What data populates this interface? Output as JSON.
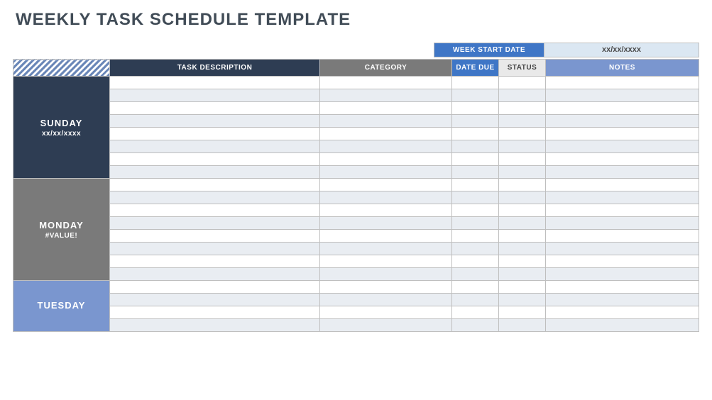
{
  "title": "WEEKLY TASK SCHEDULE TEMPLATE",
  "week_start": {
    "label": "WEEK START DATE",
    "value": "xx/xx/xxxx"
  },
  "columns": {
    "task": "TASK DESCRIPTION",
    "category": "CATEGORY",
    "date_due": "DATE DUE",
    "status": "STATUS",
    "notes": "NOTES"
  },
  "days": {
    "sunday": {
      "name": "SUNDAY",
      "date": "xx/xx/xxxx"
    },
    "monday": {
      "name": "MONDAY",
      "date": "#VALUE!"
    },
    "tuesday": {
      "name": "TUESDAY",
      "date": ""
    }
  }
}
